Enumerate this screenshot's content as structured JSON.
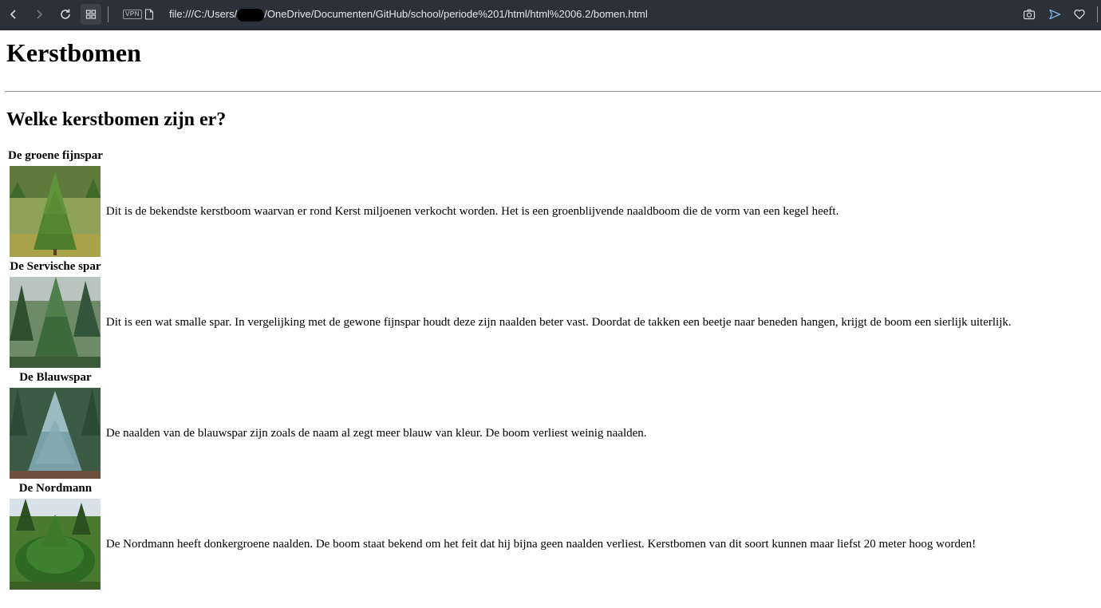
{
  "browser": {
    "url_prefix": "file:///C:/Users/",
    "url_suffix": "/OneDrive/Documenten/GitHub/school/periode%201/html/html%2006.2/bomen.html",
    "vpn_label": "VPN"
  },
  "page": {
    "title": "Kerstbomen",
    "subtitle": "Welke kerstbomen zijn er?"
  },
  "trees": [
    {
      "name": "De groene fijnspar",
      "description": "Dit is de bekendste kerstboom waarvan er rond Kerst miljoenen verkocht worden. Het is een groenblijvende naaldboom die de vorm van een kegel heeft."
    },
    {
      "name": "De Servische spar",
      "description": "Dit is een wat smalle spar. In vergelijking met de gewone fijnspar houdt deze zijn naalden beter vast. Doordat de takken een beetje naar beneden hangen, krijgt de boom een sierlijk uiterlijk."
    },
    {
      "name": "De Blauwspar",
      "description": "De naalden van de blauwspar zijn zoals de naam al zegt meer blauw van kleur. De boom verliest weinig naalden."
    },
    {
      "name": "De Nordmann",
      "description": "De Nordmann heeft donkergroene naalden. De boom staat bekend om het feit dat hij bijna geen naalden verliest. Kerstbomen van dit soort kunnen maar liefst 20 meter hoog worden!"
    }
  ]
}
